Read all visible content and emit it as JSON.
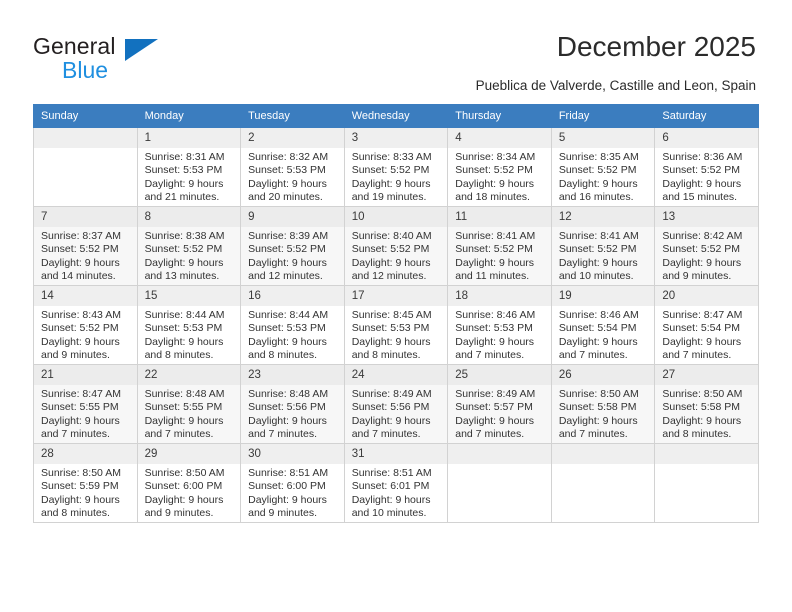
{
  "brand": {
    "name_top": "General",
    "name_bottom": "Blue",
    "accent_color": "#1271bf",
    "blue_text_color": "#1f8fe0"
  },
  "header": {
    "title": "December 2025",
    "subtitle": "Pueblica de Valverde, Castille and Leon, Spain"
  },
  "calendar": {
    "header_bg": "#3b7dbf",
    "weekday_headers": [
      "Sunday",
      "Monday",
      "Tuesday",
      "Wednesday",
      "Thursday",
      "Friday",
      "Saturday"
    ],
    "weeks": [
      [
        {
          "day": "",
          "sunrise": "",
          "sunset": "",
          "daylight1": "",
          "daylight2": ""
        },
        {
          "day": "1",
          "sunrise": "Sunrise: 8:31 AM",
          "sunset": "Sunset: 5:53 PM",
          "daylight1": "Daylight: 9 hours",
          "daylight2": "and 21 minutes."
        },
        {
          "day": "2",
          "sunrise": "Sunrise: 8:32 AM",
          "sunset": "Sunset: 5:53 PM",
          "daylight1": "Daylight: 9 hours",
          "daylight2": "and 20 minutes."
        },
        {
          "day": "3",
          "sunrise": "Sunrise: 8:33 AM",
          "sunset": "Sunset: 5:52 PM",
          "daylight1": "Daylight: 9 hours",
          "daylight2": "and 19 minutes."
        },
        {
          "day": "4",
          "sunrise": "Sunrise: 8:34 AM",
          "sunset": "Sunset: 5:52 PM",
          "daylight1": "Daylight: 9 hours",
          "daylight2": "and 18 minutes."
        },
        {
          "day": "5",
          "sunrise": "Sunrise: 8:35 AM",
          "sunset": "Sunset: 5:52 PM",
          "daylight1": "Daylight: 9 hours",
          "daylight2": "and 16 minutes."
        },
        {
          "day": "6",
          "sunrise": "Sunrise: 8:36 AM",
          "sunset": "Sunset: 5:52 PM",
          "daylight1": "Daylight: 9 hours",
          "daylight2": "and 15 minutes."
        }
      ],
      [
        {
          "day": "7",
          "sunrise": "Sunrise: 8:37 AM",
          "sunset": "Sunset: 5:52 PM",
          "daylight1": "Daylight: 9 hours",
          "daylight2": "and 14 minutes."
        },
        {
          "day": "8",
          "sunrise": "Sunrise: 8:38 AM",
          "sunset": "Sunset: 5:52 PM",
          "daylight1": "Daylight: 9 hours",
          "daylight2": "and 13 minutes."
        },
        {
          "day": "9",
          "sunrise": "Sunrise: 8:39 AM",
          "sunset": "Sunset: 5:52 PM",
          "daylight1": "Daylight: 9 hours",
          "daylight2": "and 12 minutes."
        },
        {
          "day": "10",
          "sunrise": "Sunrise: 8:40 AM",
          "sunset": "Sunset: 5:52 PM",
          "daylight1": "Daylight: 9 hours",
          "daylight2": "and 12 minutes."
        },
        {
          "day": "11",
          "sunrise": "Sunrise: 8:41 AM",
          "sunset": "Sunset: 5:52 PM",
          "daylight1": "Daylight: 9 hours",
          "daylight2": "and 11 minutes."
        },
        {
          "day": "12",
          "sunrise": "Sunrise: 8:41 AM",
          "sunset": "Sunset: 5:52 PM",
          "daylight1": "Daylight: 9 hours",
          "daylight2": "and 10 minutes."
        },
        {
          "day": "13",
          "sunrise": "Sunrise: 8:42 AM",
          "sunset": "Sunset: 5:52 PM",
          "daylight1": "Daylight: 9 hours",
          "daylight2": "and 9 minutes."
        }
      ],
      [
        {
          "day": "14",
          "sunrise": "Sunrise: 8:43 AM",
          "sunset": "Sunset: 5:52 PM",
          "daylight1": "Daylight: 9 hours",
          "daylight2": "and 9 minutes."
        },
        {
          "day": "15",
          "sunrise": "Sunrise: 8:44 AM",
          "sunset": "Sunset: 5:53 PM",
          "daylight1": "Daylight: 9 hours",
          "daylight2": "and 8 minutes."
        },
        {
          "day": "16",
          "sunrise": "Sunrise: 8:44 AM",
          "sunset": "Sunset: 5:53 PM",
          "daylight1": "Daylight: 9 hours",
          "daylight2": "and 8 minutes."
        },
        {
          "day": "17",
          "sunrise": "Sunrise: 8:45 AM",
          "sunset": "Sunset: 5:53 PM",
          "daylight1": "Daylight: 9 hours",
          "daylight2": "and 8 minutes."
        },
        {
          "day": "18",
          "sunrise": "Sunrise: 8:46 AM",
          "sunset": "Sunset: 5:53 PM",
          "daylight1": "Daylight: 9 hours",
          "daylight2": "and 7 minutes."
        },
        {
          "day": "19",
          "sunrise": "Sunrise: 8:46 AM",
          "sunset": "Sunset: 5:54 PM",
          "daylight1": "Daylight: 9 hours",
          "daylight2": "and 7 minutes."
        },
        {
          "day": "20",
          "sunrise": "Sunrise: 8:47 AM",
          "sunset": "Sunset: 5:54 PM",
          "daylight1": "Daylight: 9 hours",
          "daylight2": "and 7 minutes."
        }
      ],
      [
        {
          "day": "21",
          "sunrise": "Sunrise: 8:47 AM",
          "sunset": "Sunset: 5:55 PM",
          "daylight1": "Daylight: 9 hours",
          "daylight2": "and 7 minutes."
        },
        {
          "day": "22",
          "sunrise": "Sunrise: 8:48 AM",
          "sunset": "Sunset: 5:55 PM",
          "daylight1": "Daylight: 9 hours",
          "daylight2": "and 7 minutes."
        },
        {
          "day": "23",
          "sunrise": "Sunrise: 8:48 AM",
          "sunset": "Sunset: 5:56 PM",
          "daylight1": "Daylight: 9 hours",
          "daylight2": "and 7 minutes."
        },
        {
          "day": "24",
          "sunrise": "Sunrise: 8:49 AM",
          "sunset": "Sunset: 5:56 PM",
          "daylight1": "Daylight: 9 hours",
          "daylight2": "and 7 minutes."
        },
        {
          "day": "25",
          "sunrise": "Sunrise: 8:49 AM",
          "sunset": "Sunset: 5:57 PM",
          "daylight1": "Daylight: 9 hours",
          "daylight2": "and 7 minutes."
        },
        {
          "day": "26",
          "sunrise": "Sunrise: 8:50 AM",
          "sunset": "Sunset: 5:58 PM",
          "daylight1": "Daylight: 9 hours",
          "daylight2": "and 7 minutes."
        },
        {
          "day": "27",
          "sunrise": "Sunrise: 8:50 AM",
          "sunset": "Sunset: 5:58 PM",
          "daylight1": "Daylight: 9 hours",
          "daylight2": "and 8 minutes."
        }
      ],
      [
        {
          "day": "28",
          "sunrise": "Sunrise: 8:50 AM",
          "sunset": "Sunset: 5:59 PM",
          "daylight1": "Daylight: 9 hours",
          "daylight2": "and 8 minutes."
        },
        {
          "day": "29",
          "sunrise": "Sunrise: 8:50 AM",
          "sunset": "Sunset: 6:00 PM",
          "daylight1": "Daylight: 9 hours",
          "daylight2": "and 9 minutes."
        },
        {
          "day": "30",
          "sunrise": "Sunrise: 8:51 AM",
          "sunset": "Sunset: 6:00 PM",
          "daylight1": "Daylight: 9 hours",
          "daylight2": "and 9 minutes."
        },
        {
          "day": "31",
          "sunrise": "Sunrise: 8:51 AM",
          "sunset": "Sunset: 6:01 PM",
          "daylight1": "Daylight: 9 hours",
          "daylight2": "and 10 minutes."
        },
        {
          "day": "",
          "sunrise": "",
          "sunset": "",
          "daylight1": "",
          "daylight2": ""
        },
        {
          "day": "",
          "sunrise": "",
          "sunset": "",
          "daylight1": "",
          "daylight2": ""
        },
        {
          "day": "",
          "sunrise": "",
          "sunset": "",
          "daylight1": "",
          "daylight2": ""
        }
      ]
    ]
  }
}
